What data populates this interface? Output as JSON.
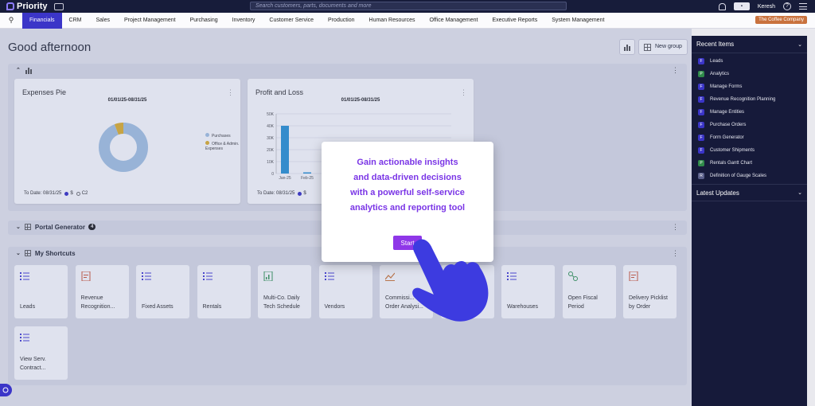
{
  "app": {
    "name": "Priority",
    "search_placeholder": "Search customers, parts, documents and more",
    "user": "Keresh",
    "help": "?"
  },
  "nav": {
    "items": [
      "Financials",
      "CRM",
      "Sales",
      "Project Management",
      "Purchasing",
      "Inventory",
      "Customer Service",
      "Production",
      "Human Resources",
      "Office Management",
      "Executive Reports",
      "System Management"
    ],
    "active": "Financials",
    "company": "The Coffee Company"
  },
  "main": {
    "greeting": "Good afternoon",
    "new_group": "New group",
    "sections": {
      "dashboard": {
        "title": ""
      },
      "portal": {
        "title": "Portal Generator",
        "badge": "4"
      },
      "shortcuts": {
        "title": "My Shortcuts"
      }
    }
  },
  "cards": {
    "expenses": {
      "title": "Expenses Pie",
      "range": "01/01/25-08/31/25",
      "todate": "To Date: 08/31/25",
      "opt1": "$",
      "opt2": "C2"
    },
    "pnl": {
      "title": "Profit and Loss",
      "range": "01/01/25-08/31/25",
      "todate": "To Date: 08/31/25",
      "opt1": "$"
    }
  },
  "chart_data": [
    {
      "type": "pie",
      "title": "Expenses Pie",
      "slices": [
        {
          "label": "Purchases",
          "value": 94,
          "color": "#a9c6e3"
        },
        {
          "label": "Office & Admin. Expenses",
          "value": 6,
          "color": "#e2b431"
        }
      ]
    },
    {
      "type": "bar",
      "title": "Profit and Loss",
      "categories": [
        "Jan-25",
        "Feb-25"
      ],
      "values": [
        40,
        1
      ],
      "ylim": [
        0,
        50
      ],
      "yticks": [
        "0",
        "10K",
        "20K",
        "30K",
        "40K",
        "50K"
      ],
      "color": "#2f97d6"
    }
  ],
  "shortcuts": [
    {
      "label": "Leads",
      "icon": "list-icon"
    },
    {
      "label": "Revenue Recognition...",
      "icon": "document-icon"
    },
    {
      "label": "Fixed Assets",
      "icon": "list-icon"
    },
    {
      "label": "Rentals",
      "icon": "list-icon"
    },
    {
      "label": "Multi-Co. Daily Tech Schedule",
      "icon": "report-icon"
    },
    {
      "label": "Vendors",
      "icon": "list-icon"
    },
    {
      "label": "Commissi... Order Analysi...",
      "icon": "chart-icon"
    },
    {
      "label": "",
      "icon": ""
    },
    {
      "label": "Warehouses",
      "icon": "list-icon"
    },
    {
      "label": "Open Fiscal Period",
      "icon": "process-icon"
    },
    {
      "label": "Delivery Picklist by Order",
      "icon": "document-icon"
    },
    {
      "label": "View Serv. Contract...",
      "icon": "list-icon"
    }
  ],
  "sidebar": {
    "recent_title": "Recent Items",
    "items": [
      {
        "label": "Leads",
        "type": "F"
      },
      {
        "label": "Analytics",
        "type": "P"
      },
      {
        "label": "Manage Forms",
        "type": "F"
      },
      {
        "label": "Revenue Recognition Planning",
        "type": "F"
      },
      {
        "label": "Manage Entities",
        "type": "F"
      },
      {
        "label": "Purchase Orders",
        "type": "F"
      },
      {
        "label": "Form Generator",
        "type": "F"
      },
      {
        "label": "Customer Shipments",
        "type": "F"
      },
      {
        "label": "Rentals Gantt Chart",
        "type": "P"
      },
      {
        "label": "Definition of Gauge Scales",
        "type": "R"
      }
    ],
    "updates_title": "Latest Updates"
  },
  "modal": {
    "lines": [
      "Gain actionable insights",
      "and data-driven decisions",
      "with a powerful self-service",
      "analytics and reporting tool"
    ],
    "button": "Start"
  },
  "colors": {
    "nav_active": "#3b35c8",
    "modal_text": "#7a35e6",
    "start_button": "#8f37e8",
    "hand": "#3d3be0"
  }
}
